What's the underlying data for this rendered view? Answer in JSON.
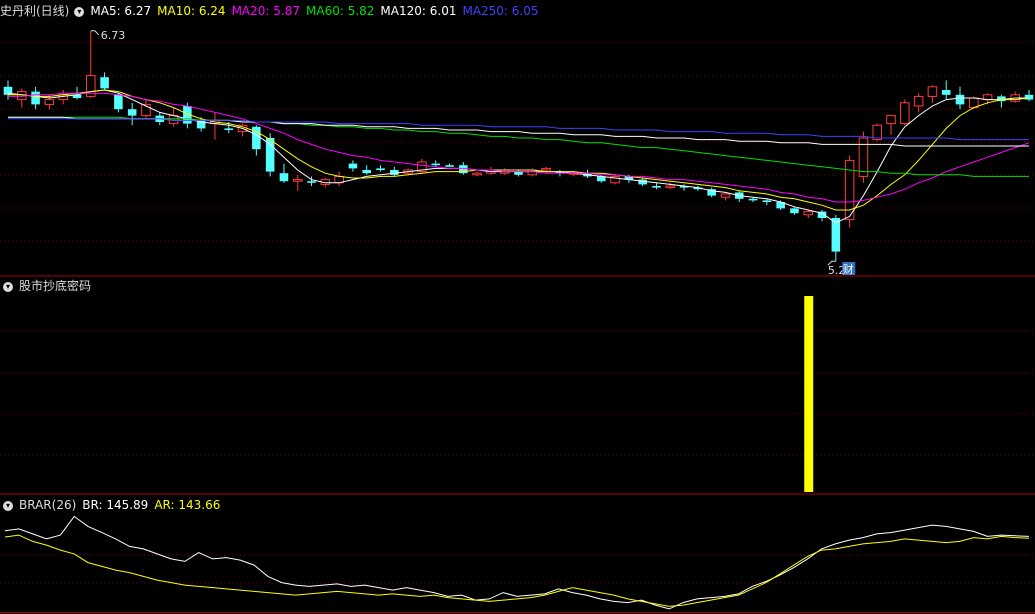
{
  "main": {
    "title": "史丹利(日线)",
    "ma": [
      {
        "label": "MA5: 6.27",
        "color": "#ffffff"
      },
      {
        "label": "MA10: 6.24",
        "color": "#ffff00"
      },
      {
        "label": "MA20: 5.87",
        "color": "#ff00ff"
      },
      {
        "label": "MA60: 5.82",
        "color": "#00e000"
      },
      {
        "label": "MA120: 6.01",
        "color": "#ffffff"
      },
      {
        "label": "MA250: 6.05",
        "color": "#4040ff"
      }
    ],
    "high_label": "6.73",
    "low_label": "5.29",
    "marker_label": "财"
  },
  "indicator": {
    "title": "股市抄底密码"
  },
  "brar": {
    "title": "BRAR(26)",
    "br_label": "BR: 145.89",
    "ar_label": "AR: 143.66",
    "br_color": "#ffffff",
    "ar_color": "#ffff00"
  },
  "colors": {
    "up": "#ff3b3b",
    "down": "#54ffff",
    "grid": "#7a0000",
    "border": "#b00000",
    "signal": "#ffff00"
  },
  "chart_data": [
    {
      "type": "candlestick",
      "ohlc": [
        [
          6.38,
          6.42,
          6.3,
          6.33
        ],
        [
          6.3,
          6.37,
          6.25,
          6.35
        ],
        [
          6.35,
          6.38,
          6.24,
          6.27
        ],
        [
          6.27,
          6.33,
          6.24,
          6.3
        ],
        [
          6.3,
          6.36,
          6.27,
          6.33
        ],
        [
          6.33,
          6.38,
          6.3,
          6.31
        ],
        [
          6.32,
          6.73,
          6.31,
          6.45
        ],
        [
          6.44,
          6.47,
          6.36,
          6.37
        ],
        [
          6.33,
          6.34,
          6.22,
          6.24
        ],
        [
          6.24,
          6.28,
          6.14,
          6.2
        ],
        [
          6.2,
          6.3,
          6.18,
          6.27
        ],
        [
          6.2,
          6.22,
          6.14,
          6.16
        ],
        [
          6.15,
          6.25,
          6.13,
          6.2
        ],
        [
          6.26,
          6.28,
          6.12,
          6.15
        ],
        [
          6.17,
          6.19,
          6.1,
          6.12
        ],
        [
          6.15,
          6.22,
          6.05,
          6.17
        ],
        [
          6.12,
          6.16,
          6.09,
          6.11
        ],
        [
          6.1,
          6.15,
          6.07,
          6.14
        ],
        [
          6.13,
          6.14,
          5.95,
          5.99
        ],
        [
          6.06,
          6.09,
          5.82,
          5.85
        ],
        [
          5.84,
          5.9,
          5.78,
          5.79
        ],
        [
          5.79,
          5.83,
          5.73,
          5.8
        ],
        [
          5.79,
          5.82,
          5.76,
          5.78
        ],
        [
          5.77,
          5.81,
          5.75,
          5.8
        ],
        [
          5.78,
          5.85,
          5.76,
          5.82
        ],
        [
          5.9,
          5.92,
          5.85,
          5.87
        ],
        [
          5.86,
          5.89,
          5.83,
          5.84
        ],
        [
          5.87,
          5.89,
          5.85,
          5.86
        ],
        [
          5.86,
          5.88,
          5.82,
          5.83
        ],
        [
          5.84,
          5.87,
          5.83,
          5.86
        ],
        [
          5.85,
          5.93,
          5.84,
          5.91
        ],
        [
          5.9,
          5.92,
          5.88,
          5.89
        ],
        [
          5.89,
          5.9,
          5.88,
          5.88
        ],
        [
          5.89,
          5.91,
          5.83,
          5.84
        ],
        [
          5.83,
          5.85,
          5.82,
          5.84
        ],
        [
          5.84,
          5.88,
          5.83,
          5.86
        ],
        [
          5.84,
          5.87,
          5.83,
          5.86
        ],
        [
          5.85,
          5.86,
          5.82,
          5.83
        ],
        [
          5.83,
          5.87,
          5.82,
          5.86
        ],
        [
          5.86,
          5.88,
          5.84,
          5.87
        ],
        [
          5.85,
          5.86,
          5.82,
          5.84
        ],
        [
          5.84,
          5.85,
          5.82,
          5.84
        ],
        [
          5.84,
          5.86,
          5.81,
          5.82
        ],
        [
          5.82,
          5.83,
          5.78,
          5.79
        ],
        [
          5.78,
          5.83,
          5.77,
          5.82
        ],
        [
          5.82,
          5.83,
          5.78,
          5.8
        ],
        [
          5.8,
          5.81,
          5.76,
          5.77
        ],
        [
          5.76,
          5.78,
          5.74,
          5.75
        ],
        [
          5.75,
          5.78,
          5.74,
          5.76
        ],
        [
          5.76,
          5.77,
          5.73,
          5.75
        ],
        [
          5.75,
          5.76,
          5.73,
          5.74
        ],
        [
          5.74,
          5.75,
          5.69,
          5.7
        ],
        [
          5.69,
          5.72,
          5.67,
          5.71
        ],
        [
          5.72,
          5.73,
          5.66,
          5.68
        ],
        [
          5.68,
          5.69,
          5.66,
          5.67
        ],
        [
          5.67,
          5.68,
          5.64,
          5.66
        ],
        [
          5.66,
          5.67,
          5.61,
          5.62
        ],
        [
          5.62,
          5.63,
          5.58,
          5.59
        ],
        [
          5.58,
          5.61,
          5.56,
          5.6
        ],
        [
          5.6,
          5.61,
          5.54,
          5.56
        ],
        [
          5.56,
          5.58,
          5.29,
          5.35
        ],
        [
          5.55,
          5.95,
          5.5,
          5.92
        ],
        [
          5.82,
          6.1,
          5.78,
          6.06
        ],
        [
          6.05,
          6.15,
          6.04,
          6.14
        ],
        [
          6.15,
          6.2,
          6.08,
          6.2
        ],
        [
          6.15,
          6.3,
          6.14,
          6.28
        ],
        [
          6.26,
          6.34,
          6.22,
          6.32
        ],
        [
          6.32,
          6.39,
          6.28,
          6.38
        ],
        [
          6.36,
          6.42,
          6.3,
          6.33
        ],
        [
          6.33,
          6.38,
          6.24,
          6.27
        ],
        [
          6.25,
          6.32,
          6.24,
          6.31
        ],
        [
          6.3,
          6.34,
          6.27,
          6.33
        ],
        [
          6.32,
          6.33,
          6.25,
          6.29
        ],
        [
          6.29,
          6.35,
          6.28,
          6.33
        ],
        [
          6.33,
          6.36,
          6.29,
          6.3
        ]
      ],
      "ma": [
        {
          "name": "MA5",
          "color": "#ffffff",
          "values": [
            6.34,
            6.33,
            6.32,
            6.31,
            6.32,
            6.33,
            6.35,
            6.36,
            6.34,
            6.3,
            6.26,
            6.22,
            6.2,
            6.18,
            6.16,
            6.15,
            6.14,
            6.12,
            6.08,
            6.02,
            5.94,
            5.86,
            5.8,
            5.78,
            5.78,
            5.8,
            5.82,
            5.83,
            5.84,
            5.85,
            5.86,
            5.87,
            5.87,
            5.87,
            5.86,
            5.85,
            5.85,
            5.85,
            5.85,
            5.85,
            5.85,
            5.84,
            5.83,
            5.82,
            5.81,
            5.8,
            5.79,
            5.78,
            5.77,
            5.76,
            5.75,
            5.73,
            5.72,
            5.7,
            5.69,
            5.68,
            5.66,
            5.63,
            5.61,
            5.59,
            5.53,
            5.57,
            5.7,
            5.85,
            6.01,
            6.13,
            6.2,
            6.26,
            6.3,
            6.31,
            6.31,
            6.3,
            6.3,
            6.31,
            6.31
          ]
        },
        {
          "name": "MA10",
          "color": "#ffff00",
          "values": [
            6.33,
            6.33,
            6.32,
            6.32,
            6.33,
            6.34,
            6.35,
            6.36,
            6.35,
            6.32,
            6.3,
            6.28,
            6.25,
            6.21,
            6.18,
            6.16,
            6.15,
            6.13,
            6.1,
            6.05,
            5.99,
            5.93,
            5.88,
            5.84,
            5.82,
            5.81,
            5.81,
            5.82,
            5.82,
            5.83,
            5.84,
            5.85,
            5.85,
            5.85,
            5.86,
            5.86,
            5.86,
            5.86,
            5.86,
            5.85,
            5.85,
            5.85,
            5.84,
            5.84,
            5.83,
            5.82,
            5.81,
            5.8,
            5.79,
            5.78,
            5.77,
            5.76,
            5.75,
            5.73,
            5.72,
            5.71,
            5.69,
            5.68,
            5.66,
            5.64,
            5.61,
            5.61,
            5.64,
            5.7,
            5.77,
            5.83,
            5.92,
            6.02,
            6.12,
            6.2,
            6.25,
            6.28,
            6.3,
            6.3,
            6.31
          ]
        },
        {
          "name": "MA20",
          "color": "#ff00ff",
          "values": [
            6.32,
            6.32,
            6.33,
            6.33,
            6.34,
            6.34,
            6.34,
            6.34,
            6.33,
            6.32,
            6.3,
            6.29,
            6.27,
            6.26,
            6.24,
            6.22,
            6.2,
            6.18,
            6.15,
            6.12,
            6.09,
            6.05,
            6.02,
            5.99,
            5.97,
            5.95,
            5.94,
            5.92,
            5.91,
            5.9,
            5.89,
            5.88,
            5.87,
            5.87,
            5.86,
            5.86,
            5.85,
            5.85,
            5.85,
            5.84,
            5.84,
            5.84,
            5.84,
            5.83,
            5.83,
            5.82,
            5.82,
            5.81,
            5.8,
            5.8,
            5.79,
            5.78,
            5.77,
            5.76,
            5.75,
            5.74,
            5.72,
            5.71,
            5.69,
            5.68,
            5.66,
            5.66,
            5.67,
            5.69,
            5.71,
            5.74,
            5.78,
            5.81,
            5.85,
            5.88,
            5.91,
            5.94,
            5.97,
            6.0,
            6.03
          ]
        },
        {
          "name": "MA60",
          "color": "#00e000",
          "values": [
            6.19,
            6.19,
            6.19,
            6.19,
            6.19,
            6.19,
            6.19,
            6.19,
            6.19,
            6.18,
            6.18,
            6.18,
            6.18,
            6.18,
            6.17,
            6.17,
            6.17,
            6.16,
            6.16,
            6.16,
            6.15,
            6.15,
            6.14,
            6.14,
            6.13,
            6.13,
            6.12,
            6.12,
            6.11,
            6.11,
            6.1,
            6.1,
            6.09,
            6.09,
            6.08,
            6.07,
            6.07,
            6.06,
            6.06,
            6.05,
            6.05,
            6.04,
            6.03,
            6.03,
            6.02,
            6.01,
            6.0,
            6.0,
            5.99,
            5.98,
            5.97,
            5.96,
            5.95,
            5.94,
            5.93,
            5.92,
            5.91,
            5.9,
            5.89,
            5.88,
            5.87,
            5.86,
            5.85,
            5.85,
            5.84,
            5.84,
            5.83,
            5.83,
            5.83,
            5.83,
            5.82,
            5.82,
            5.82,
            5.82,
            5.82
          ]
        },
        {
          "name": "MA120",
          "color": "#ffffff",
          "values": [
            6.19,
            6.19,
            6.19,
            6.19,
            6.19,
            6.18,
            6.18,
            6.18,
            6.18,
            6.18,
            6.18,
            6.18,
            6.17,
            6.17,
            6.17,
            6.17,
            6.17,
            6.16,
            6.16,
            6.16,
            6.15,
            6.15,
            6.15,
            6.14,
            6.14,
            6.14,
            6.13,
            6.13,
            6.13,
            6.12,
            6.12,
            6.12,
            6.11,
            6.11,
            6.11,
            6.1,
            6.1,
            6.1,
            6.09,
            6.09,
            6.09,
            6.08,
            6.08,
            6.08,
            6.07,
            6.07,
            6.07,
            6.06,
            6.06,
            6.06,
            6.05,
            6.05,
            6.05,
            6.04,
            6.04,
            6.04,
            6.03,
            6.03,
            6.03,
            6.02,
            6.02,
            6.02,
            6.02,
            6.02,
            6.02,
            6.01,
            6.01,
            6.01,
            6.01,
            6.01,
            6.01,
            6.01,
            6.01,
            6.01,
            6.01
          ]
        },
        {
          "name": "MA250",
          "color": "#4040ff",
          "values": [
            6.18,
            6.18,
            6.18,
            6.18,
            6.18,
            6.18,
            6.18,
            6.18,
            6.18,
            6.18,
            6.18,
            6.18,
            6.17,
            6.17,
            6.17,
            6.17,
            6.17,
            6.17,
            6.16,
            6.16,
            6.16,
            6.16,
            6.16,
            6.16,
            6.15,
            6.15,
            6.15,
            6.15,
            6.15,
            6.15,
            6.14,
            6.14,
            6.14,
            6.14,
            6.14,
            6.13,
            6.13,
            6.13,
            6.13,
            6.13,
            6.12,
            6.12,
            6.12,
            6.12,
            6.11,
            6.11,
            6.11,
            6.11,
            6.1,
            6.1,
            6.1,
            6.1,
            6.09,
            6.09,
            6.09,
            6.09,
            6.08,
            6.08,
            6.08,
            6.07,
            6.07,
            6.07,
            6.07,
            6.06,
            6.06,
            6.06,
            6.06,
            6.06,
            6.06,
            6.05,
            6.05,
            6.05,
            6.05,
            6.05,
            6.05
          ]
        }
      ],
      "ylim": [
        5.21,
        6.81
      ]
    },
    {
      "type": "bar",
      "series": [
        {
          "values": [
            1
          ]
        }
      ],
      "signal_index": 58,
      "ylim": [
        0,
        1
      ]
    },
    {
      "type": "line",
      "series": [
        {
          "name": "BR",
          "color": "#ffffff",
          "values": [
            155,
            158,
            150,
            142,
            148,
            178,
            162,
            152,
            142,
            130,
            126,
            118,
            110,
            106,
            120,
            110,
            112,
            108,
            100,
            82,
            72,
            68,
            66,
            68,
            70,
            66,
            68,
            64,
            60,
            64,
            60,
            56,
            50,
            52,
            44,
            46,
            56,
            50,
            52,
            54,
            62,
            56,
            52,
            46,
            42,
            40,
            44,
            36,
            30,
            40,
            46,
            48,
            50,
            54,
            66,
            74,
            84,
            96,
            110,
            126,
            134,
            140,
            144,
            150,
            152,
            156,
            160,
            164,
            162,
            158,
            154,
            146,
            148,
            147,
            146
          ]
        },
        {
          "name": "AR",
          "color": "#ffff00",
          "values": [
            145,
            148,
            138,
            132,
            124,
            118,
            104,
            98,
            92,
            88,
            82,
            76,
            72,
            68,
            66,
            64,
            62,
            60,
            58,
            56,
            54,
            52,
            54,
            56,
            58,
            56,
            54,
            52,
            54,
            52,
            50,
            52,
            48,
            46,
            44,
            42,
            44,
            46,
            48,
            52,
            58,
            64,
            60,
            56,
            52,
            46,
            42,
            38,
            34,
            36,
            40,
            44,
            48,
            52,
            62,
            72,
            86,
            100,
            114,
            124,
            126,
            130,
            134,
            136,
            138,
            142,
            140,
            138,
            136,
            138,
            144,
            142,
            146,
            144,
            143
          ]
        }
      ],
      "ylim": [
        25,
        185
      ]
    }
  ]
}
